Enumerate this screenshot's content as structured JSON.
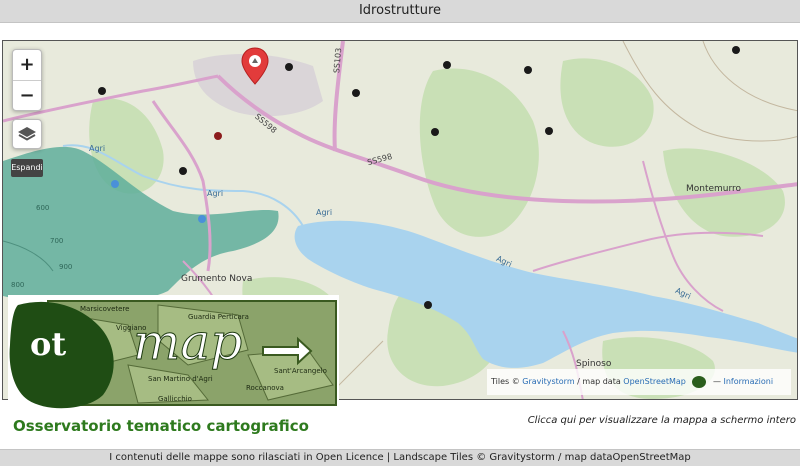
{
  "page": {
    "title": "Idrostrutture"
  },
  "map": {
    "zoom_in_label": "+",
    "zoom_out_label": "−",
    "layers_icon": "layers-icon",
    "expand_label": "Espandi",
    "places": {
      "montemurro": "Montemurro",
      "grumento": "Grumento Nova",
      "spinoso": "Spinoso"
    },
    "roads": {
      "ss598_a": "SS598",
      "ss598_b": "SS598",
      "ss103": "SS103"
    },
    "rivers": {
      "agri_1": "Agri",
      "agri_2": "Agri",
      "agri_3": "Agri",
      "agri_4": "Agri",
      "agri_5": "Agri"
    },
    "contours": {
      "c600": "600",
      "c700": "700",
      "c800": "800",
      "c900": "900"
    },
    "attribution": {
      "tiles_prefix": "Tiles ©",
      "tiles_link": "Gravitystorm",
      "mapdata_prefix": "/ map data",
      "mapdata_link": "OpenStreetMap",
      "info_link": "Informazioni"
    },
    "colors": {
      "water": "#a9d3ee",
      "forest": "#c9e0b6",
      "road": "#d9a2cc",
      "marker": "#e23b3b",
      "point": "#1a1a1a"
    }
  },
  "logo": {
    "emblem": "ot",
    "word": "map",
    "caption": "Osservatorio tematico cartografico",
    "map_labels": {
      "a": "Marsicovetere",
      "b": "Viggiano",
      "c": "Guardia Perticara",
      "d": "Sant'Arcangelo",
      "e": "San Martino d'Agri",
      "f": "Roccanova",
      "g": "Gallicchio"
    }
  },
  "fullscreen_text": "Clicca qui per visualizzare la mappa a schermo intero",
  "footer": {
    "text": "I contenuti delle mappe sono rilasciati in Open Licence | Landscape Tiles ©",
    "link1": "Gravitystorm",
    "sep": "/ map data",
    "link2": "OpenStreetMap"
  }
}
